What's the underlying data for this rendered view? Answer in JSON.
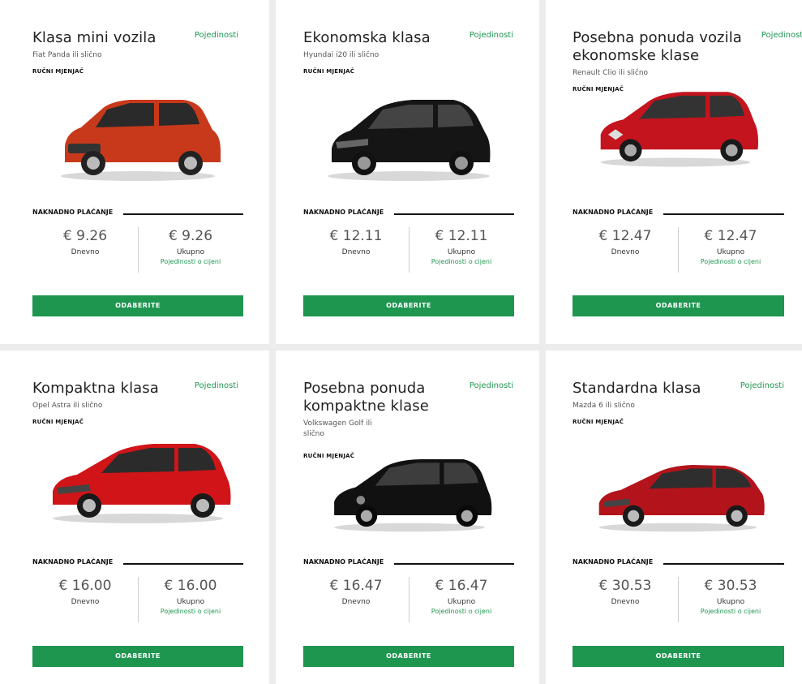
{
  "cards": [
    {
      "title": "Klasa mini vozila",
      "details": "Pojedinosti",
      "model": "Fiat Panda ili slično",
      "transmission": "RUČNI MJENJAČ",
      "payment_label": "NAKNADNO PLAĆANJE",
      "daily_price": "€ 9.26",
      "daily_label": "Dnevno",
      "total_price": "€ 9.26",
      "total_label": "Ukupno",
      "price_details": "Pojedinosti o cijeni",
      "select": "ODABERITE",
      "car_color": "#c8391b"
    },
    {
      "title": "Ekonomska klasa",
      "details": "Pojedinosti",
      "model": "Hyundai i20 ili slično",
      "transmission": "RUČNI MJENJAČ",
      "payment_label": "NAKNADNO PLAĆANJE",
      "daily_price": "€ 12.11",
      "daily_label": "Dnevno",
      "total_price": "€ 12.11",
      "total_label": "Ukupno",
      "price_details": "Pojedinosti o cijeni",
      "select": "ODABERITE",
      "car_color": "#151515"
    },
    {
      "title": "Posebna ponuda vozila ekonomske klase",
      "details": "Pojedinosti",
      "model": "Renault Clio ili slično",
      "transmission": "RUČNI MJENJAČ",
      "payment_label": "NAKNADNO PLAĆANJE",
      "daily_price": "€ 12.47",
      "daily_label": "Dnevno",
      "total_price": "€ 12.47",
      "total_label": "Ukupno",
      "price_details": "Pojedinosti o cijeni",
      "select": "ODABERITE",
      "car_color": "#c4141d"
    },
    {
      "title": "Kompaktna klasa",
      "details": "Pojedinosti",
      "model": "Opel Astra ili slično",
      "transmission": "RUČNI MJENJAČ",
      "payment_label": "NAKNADNO PLAĆANJE",
      "daily_price": "€ 16.00",
      "daily_label": "Dnevno",
      "total_price": "€ 16.00",
      "total_label": "Ukupno",
      "price_details": "Pojedinosti o cijeni",
      "select": "ODABERITE",
      "car_color": "#d01418"
    },
    {
      "title": "Posebna ponuda kompaktne klase",
      "details": "Pojedinosti",
      "model": "Volkswagen Golf ili slično",
      "transmission": "RUČNI MJENJAČ",
      "payment_label": "NAKNADNO PLAĆANJE",
      "daily_price": "€ 16.47",
      "daily_label": "Dnevno",
      "total_price": "€ 16.47",
      "total_label": "Ukupno",
      "price_details": "Pojedinosti o cijeni",
      "select": "ODABERITE",
      "car_color": "#111111"
    },
    {
      "title": "Standardna klasa",
      "details": "Pojedinosti",
      "model": "Mazda 6 ili slično",
      "transmission": "RUČNI MJENJAČ",
      "payment_label": "NAKNADNO PLAĆANJE",
      "daily_price": "€ 30.53",
      "daily_label": "Dnevno",
      "total_price": "€ 30.53",
      "total_label": "Ukupno",
      "price_details": "Pojedinosti o cijeni",
      "select": "ODABERITE",
      "car_color": "#b3141b"
    }
  ],
  "colors": {
    "accent": "#1e9650",
    "background": "#ececec"
  }
}
